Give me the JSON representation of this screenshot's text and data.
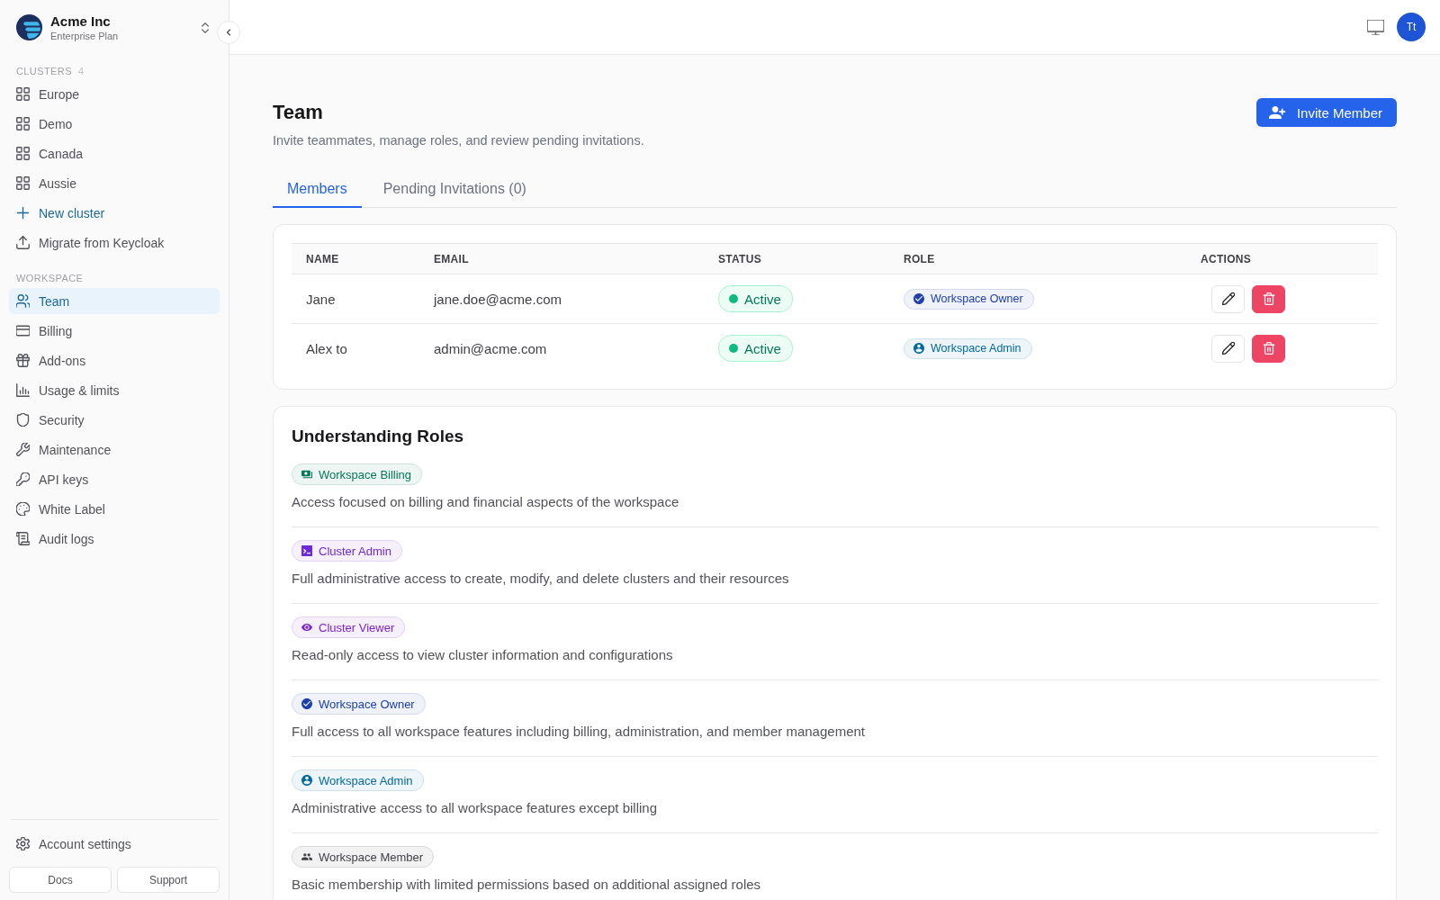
{
  "sidebar": {
    "org": {
      "name": "Acme Inc",
      "plan": "Enterprise Plan"
    },
    "clusters": {
      "heading": "CLUSTERS",
      "count": "4",
      "items": [
        {
          "label": "Europe",
          "kind": "cluster"
        },
        {
          "label": "Demo",
          "kind": "cluster"
        },
        {
          "label": "Canada",
          "kind": "cluster"
        },
        {
          "label": "Aussie",
          "kind": "cluster"
        },
        {
          "label": "New cluster",
          "kind": "add"
        },
        {
          "label": "Migrate from Keycloak",
          "kind": "import"
        }
      ]
    },
    "workspace": {
      "heading": "WORKSPACE",
      "items": [
        {
          "label": "Team",
          "selected": true
        },
        {
          "label": "Billing",
          "selected": false
        },
        {
          "label": "Add-ons",
          "selected": false
        },
        {
          "label": "Usage & limits",
          "selected": false
        },
        {
          "label": "Security",
          "selected": false
        },
        {
          "label": "Maintenance",
          "selected": false
        },
        {
          "label": "API keys",
          "selected": false
        },
        {
          "label": "White Label",
          "selected": false
        },
        {
          "label": "Audit logs",
          "selected": false
        }
      ]
    },
    "account_settings": "Account settings",
    "buttons": [
      "Docs",
      "Support"
    ]
  },
  "header": {
    "avatar": "Tt"
  },
  "page": {
    "title": "Team",
    "subtitle": "Invite teammates, manage roles, and review pending invitations.",
    "invite_button": "Invite Member"
  },
  "tabs": [
    {
      "label": "Members",
      "selected": true
    },
    {
      "label": "Pending Invitations (0)",
      "selected": false
    }
  ],
  "members_table": {
    "columns": [
      "NAME",
      "EMAIL",
      "STATUS",
      "ROLE",
      "ACTIONS"
    ],
    "rows": [
      {
        "name": "Jane",
        "email": "jane.doe@acme.com",
        "status": {
          "label": "Active",
          "kind": "active"
        },
        "role": {
          "label": "Workspace Owner",
          "kind": "owner",
          "color": "#1e40af"
        }
      },
      {
        "name": "Alex to",
        "email": "admin@acme.com",
        "status": {
          "label": "Active",
          "kind": "active"
        },
        "role": {
          "label": "Workspace Admin",
          "kind": "admin",
          "color": "#0369a1"
        }
      }
    ]
  },
  "roles": {
    "title": "Understanding Roles",
    "items": [
      {
        "label": "Workspace Billing",
        "kind": "billing",
        "color": "#047857",
        "description": "Access focused on billing and financial aspects of the workspace"
      },
      {
        "label": "Cluster Admin",
        "kind": "cluster_admin",
        "color": "#6d28d9",
        "description": "Full administrative access to create, modify, and delete clusters and their resources"
      },
      {
        "label": "Cluster Viewer",
        "kind": "cluster_viewer",
        "color": "#7e22ce",
        "description": "Read-only access to view cluster information and configurations"
      },
      {
        "label": "Workspace Owner",
        "kind": "owner",
        "color": "#1e40af",
        "description": "Full access to all workspace features including billing, administration, and member management"
      },
      {
        "label": "Workspace Admin",
        "kind": "admin",
        "color": "#0369a1",
        "description": "Administrative access to all workspace features except billing"
      },
      {
        "label": "Workspace Member",
        "kind": "member",
        "color": "#3f3f46",
        "description": "Basic membership with limited permissions based on additional assigned roles"
      }
    ]
  }
}
